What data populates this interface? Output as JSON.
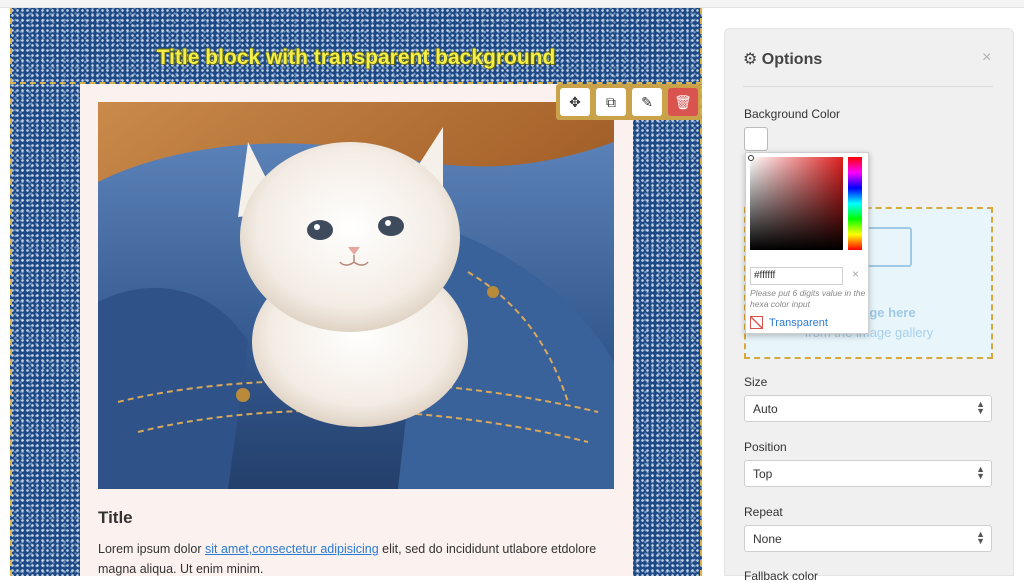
{
  "canvas": {
    "title_block_text": "Title block with transparent background",
    "toolbar": {
      "move_icon": "move-icon",
      "duplicate_icon": "duplicate-icon",
      "edit_icon": "pencil-icon",
      "delete_icon": "trash-icon"
    },
    "article": {
      "title": "Title",
      "body_before_link": "Lorem ipsum dolor ",
      "link_text": "sit amet,consectetur adipisicing",
      "body_after_link": " elit, sed do incididunt utlabore etdolore magna aliqua. Ut enim minim."
    }
  },
  "options": {
    "header": "Options",
    "header_icon": "gear-icon",
    "close_label": "×",
    "background_color_label": "Background Color",
    "color_picker": {
      "hex_value": "#ffffff",
      "clear_label": "×",
      "hint": "Please put 6 digits value in the hexa color input",
      "transparent_label": "Transparent"
    },
    "dropzone": {
      "line1": "our image here",
      "line2": "from the image gallery"
    },
    "size": {
      "label": "Size",
      "value": "Auto"
    },
    "position": {
      "label": "Position",
      "value": "Top"
    },
    "repeat": {
      "label": "Repeat",
      "value": "None"
    },
    "fallback_label": "Fallback color"
  },
  "colors": {
    "accent_gold": "#c9a24a",
    "delete_red": "#d9534f",
    "title_yellow": "#f3f04a",
    "link_blue": "#2a7bd4"
  }
}
